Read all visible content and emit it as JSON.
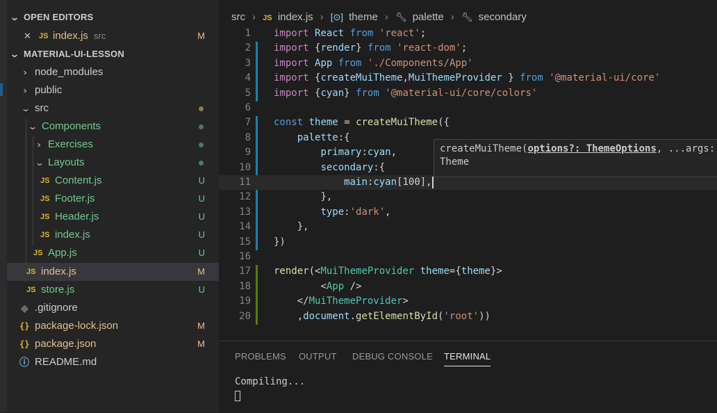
{
  "sidebar": {
    "open_editors_title": "OPEN EDITORS",
    "open_editor": {
      "icon": "JS",
      "name": "index.js",
      "folder": "src",
      "badge": "M",
      "close": "✕"
    },
    "project_title": "MATERIAL-UI-LESSON",
    "tree": [
      {
        "name": "node_modules",
        "kind": "folder",
        "expanded": false
      },
      {
        "name": "public",
        "kind": "folder",
        "expanded": false
      },
      {
        "name": "src",
        "kind": "folder",
        "expanded": true
      },
      {
        "name": "Components",
        "kind": "folder",
        "expanded": true
      },
      {
        "name": "Exercises",
        "kind": "folder",
        "expanded": false
      },
      {
        "name": "Layouts",
        "kind": "folder",
        "expanded": true
      },
      {
        "name": "Content.js",
        "icon": "JS",
        "badge": "U"
      },
      {
        "name": "Footer.js",
        "icon": "JS",
        "badge": "U"
      },
      {
        "name": "Header.js",
        "icon": "JS",
        "badge": "U"
      },
      {
        "name": "index.js",
        "icon": "JS",
        "badge": "U"
      },
      {
        "name": "App.js",
        "icon": "JS",
        "badge": "U"
      },
      {
        "name": "index.js",
        "icon": "JS",
        "badge": "M",
        "selected": true
      },
      {
        "name": "store.js",
        "icon": "JS",
        "badge": "U"
      },
      {
        "name": ".gitignore",
        "icon": "◆"
      },
      {
        "name": "package-lock.json",
        "icon": "{}",
        "badge": "M"
      },
      {
        "name": "package.json",
        "icon": "{}",
        "badge": "M"
      },
      {
        "name": "README.md",
        "icon": "ⓘ"
      }
    ]
  },
  "breadcrumb": [
    "src",
    "index.js",
    "theme",
    "palette",
    "secondary"
  ],
  "code_lines": [
    "import React from 'react';",
    "import {render} from 'react-dom';",
    "import App from './Components/App'",
    "import {createMuiTheme,MuiThemeProvider } from '@material-ui/core'",
    "import {cyan} from '@material-ui/core/colors'",
    "",
    "const theme = createMuiTheme({",
    "    palette:{",
    "        primary:cyan,",
    "        secondary:{",
    "            main:cyan[100],",
    "        },",
    "        type:'dark',",
    "    },",
    "})",
    "",
    "render(<MuiThemeProvider theme={theme}>",
    "        <App />",
    "    </MuiThemeProvider>",
    "    ,document.getElementById('root'))"
  ],
  "tooltip": {
    "fn": "createMuiTheme(",
    "param": "options?: ThemeOptions",
    "rest": ", ...args:",
    "return_type": "Theme"
  },
  "panel": {
    "tabs": [
      "PROBLEMS",
      "OUTPUT",
      "DEBUG CONSOLE",
      "TERMINAL"
    ],
    "active_tab": "TERMINAL",
    "terminal_text": "Compiling..."
  },
  "colors": {
    "untracked": "#73c991",
    "modified": "#e2c08d",
    "accent": "#1b81a8"
  }
}
